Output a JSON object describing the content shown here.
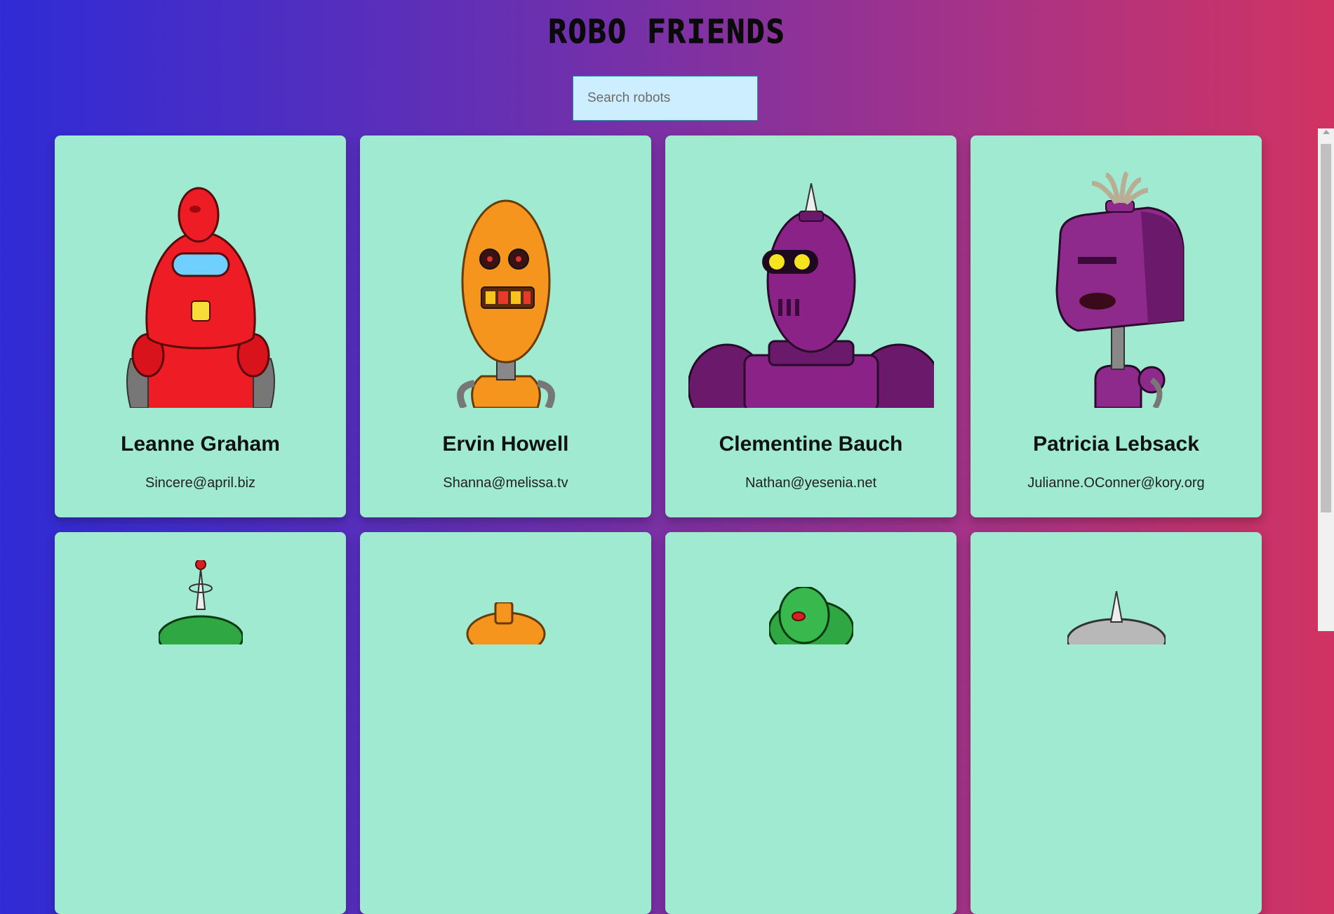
{
  "header": {
    "title": "ROBO FRIENDS"
  },
  "search": {
    "placeholder": "Search robots"
  },
  "robots": [
    {
      "name": "Leanne Graham",
      "email": "Sincere@april.biz",
      "color": "#ee1c24",
      "icon": "red-robot-icon"
    },
    {
      "name": "Ervin Howell",
      "email": "Shanna@melissa.tv",
      "color": "#f6951e",
      "icon": "orange-robot-icon"
    },
    {
      "name": "Clementine Bauch",
      "email": "Nathan@yesenia.net",
      "color": "#8b2288",
      "icon": "purple-robot-icon"
    },
    {
      "name": "Patricia Lebsack",
      "email": "Julianne.OConner@kory.org",
      "color": "#8e2a8c",
      "icon": "purple-robot-icon"
    },
    {
      "name": "",
      "email": "",
      "color": "#2fa843",
      "icon": "green-robot-icon"
    },
    {
      "name": "",
      "email": "",
      "color": "#f6951e",
      "icon": "orange-robot-icon"
    },
    {
      "name": "",
      "email": "",
      "color": "#2fa843",
      "icon": "green-robot-icon"
    },
    {
      "name": "",
      "email": "",
      "color": "#b8b8b8",
      "icon": "gray-robot-icon"
    }
  ]
}
